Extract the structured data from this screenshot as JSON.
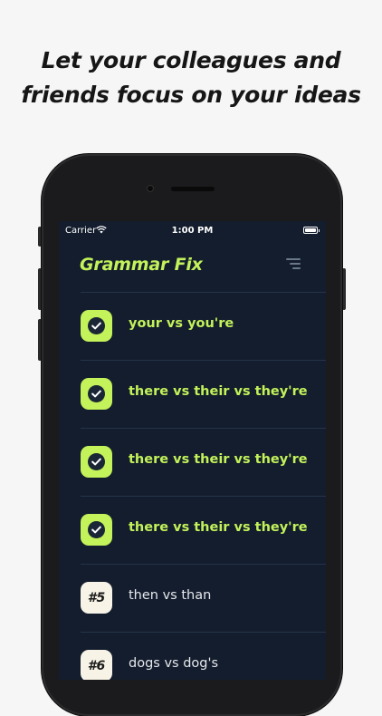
{
  "headline": {
    "line1": "Let your colleagues and",
    "line2": "friends focus on your ideas"
  },
  "status_bar": {
    "carrier": "Carrier",
    "time": "1:00 PM"
  },
  "app": {
    "title": "Grammar Fix",
    "menu_icon": "menu-lines-icon"
  },
  "colors": {
    "accent": "#c3f25a",
    "screen_bg": "#131d2d",
    "badge_bg": "#f7f3e6"
  },
  "lessons": [
    {
      "label": "your vs you're",
      "status": "completed",
      "badge": ""
    },
    {
      "label": "there vs their vs they're",
      "status": "completed",
      "badge": ""
    },
    {
      "label": "there vs their vs they're",
      "status": "completed",
      "badge": ""
    },
    {
      "label": "there vs their vs they're",
      "status": "completed",
      "badge": ""
    },
    {
      "label": "then vs than",
      "status": "pending",
      "badge": "#5"
    },
    {
      "label": "dogs vs dog's",
      "status": "pending",
      "badge": "#6"
    }
  ]
}
